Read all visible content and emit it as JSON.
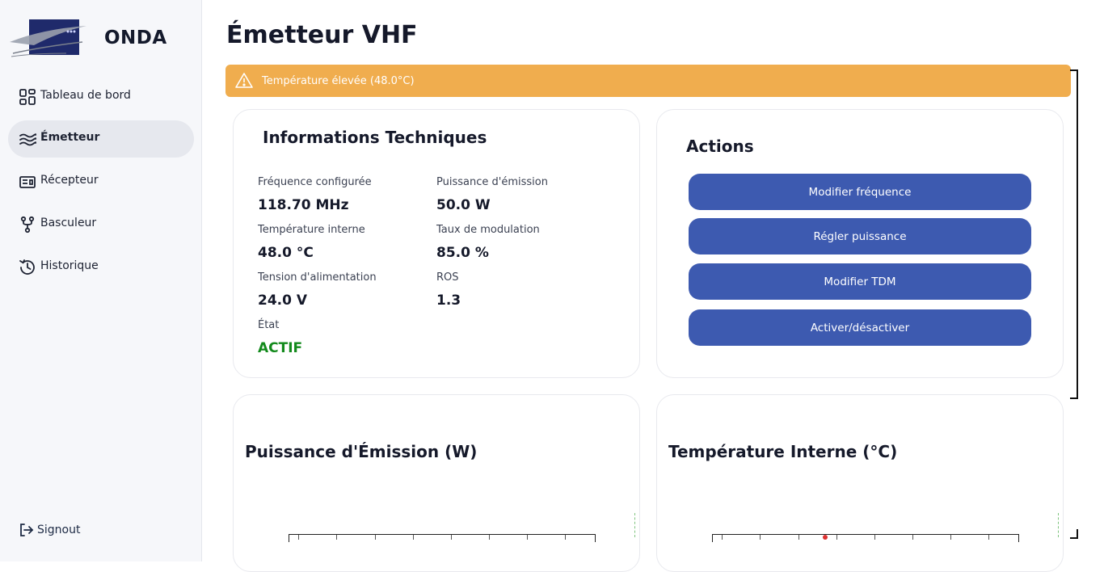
{
  "app": {
    "name": "ONDA"
  },
  "sidebar": {
    "items": [
      {
        "label": "Tableau de bord",
        "icon": "dashboard-icon",
        "active": false
      },
      {
        "label": "Émetteur",
        "icon": "waves-icon",
        "active": true
      },
      {
        "label": "Récepteur",
        "icon": "radio-icon",
        "active": false
      },
      {
        "label": "Basculeur",
        "icon": "fork-icon",
        "active": false
      },
      {
        "label": "Historique",
        "icon": "history-icon",
        "active": false
      }
    ],
    "signout": {
      "label": "Signout",
      "icon": "logout-icon"
    }
  },
  "page": {
    "title": "Émetteur VHF"
  },
  "alert": {
    "text": "Température élevée (48.0°C)",
    "icon": "warning-icon",
    "color": "#f0ad4e"
  },
  "info": {
    "title": "Informations Techniques",
    "fields": [
      {
        "label": "Fréquence configurée",
        "value": "118.70 MHz"
      },
      {
        "label": "Puissance d'émission",
        "value": "50.0 W"
      },
      {
        "label": "Température interne",
        "value": "48.0 °C"
      },
      {
        "label": "Taux de modulation",
        "value": "85.0 %"
      },
      {
        "label": "Tension d'alimentation",
        "value": "24.0 V"
      },
      {
        "label": "ROS",
        "value": "1.3"
      },
      {
        "label": "État",
        "value": "ACTIF",
        "status_color": "#138a1c"
      }
    ]
  },
  "actions": {
    "title": "Actions",
    "buttons": [
      "Modifier fréquence",
      "Régler puissance",
      "Modifier TDM",
      "Activer/désactiver"
    ],
    "button_color": "#3d5ab0"
  },
  "charts": {
    "power": {
      "title": "Puissance d'Émission (W)"
    },
    "temperature": {
      "title": "Température Interne (°C)"
    }
  }
}
